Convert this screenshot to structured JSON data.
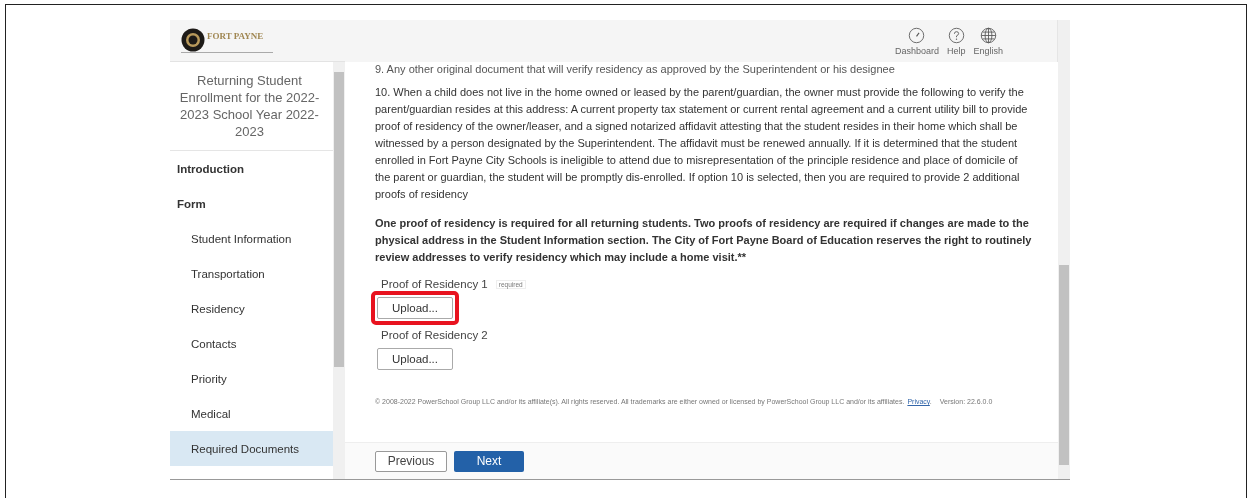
{
  "header": {
    "logo_text": "FORT PAYNE",
    "nav": [
      {
        "kind": "dashboard",
        "label": "Dashboard"
      },
      {
        "kind": "help",
        "label": "Help"
      },
      {
        "kind": "language",
        "label": "English"
      }
    ]
  },
  "sidebar": {
    "title": "Returning Student Enrollment for the 2022-2023 School Year 2022-2023",
    "items": [
      {
        "label": "Introduction",
        "selected": false
      },
      {
        "label": "Form",
        "selected": false,
        "children": [
          {
            "label": "Student Information",
            "selected": false
          },
          {
            "label": "Transportation",
            "selected": false
          },
          {
            "label": "Residency",
            "selected": false
          },
          {
            "label": "Contacts",
            "selected": false
          },
          {
            "label": "Priority",
            "selected": false
          },
          {
            "label": "Medical",
            "selected": false
          },
          {
            "label": "Required Documents",
            "selected": true
          }
        ]
      }
    ]
  },
  "content": {
    "paragraphs": [
      {
        "bold": false,
        "text": "9. Any other original document that will verify residency as approved by the Superintendent or his designee"
      },
      {
        "bold": false,
        "text": "10. When a child does not live in the home owned or leased by the parent/guardian, the owner must provide the following to verify the parent/guardian resides at this address: A current property tax statement or current rental agreement and a current utility bill to provide proof of residency of the owner/leaser, and a signed notarized affidavit attesting that the student resides in their home which shall be witnessed by a person designated by the Superintendent. The affidavit must be renewed annually. If it is determined that the student enrolled in Fort Payne City Schools is ineligible to attend due to misrepresentation of the principle residence and place of domicile of the parent or guardian, the student will be promptly dis-enrolled. If option 10 is selected, then you are required to provide 2 additional proofs of residency"
      },
      {
        "bold": true,
        "text": "One proof of residency is required for all returning students. Two proofs of residency are required if changes are made to the physical address in the Student Information section. The City of Fort Payne Board of Education reserves the right to routinely review addresses to verify residency which may include a home visit.**"
      }
    ],
    "uploads": [
      {
        "label": "Proof of Residency 1",
        "required_tag": "required",
        "button": "Upload...",
        "highlighted": true
      },
      {
        "label": "Proof of Residency 2",
        "button": "Upload...",
        "highlighted": false
      }
    ],
    "footer": {
      "copyright": "© 2008-2022 PowerSchool Group LLC and/or its affiliate(s). All rights reserved. All trademarks are either owned or licensed by PowerSchool Group LLC and/or its affiliates.",
      "privacy_link": "Privacy",
      "privacy_suffix": ".",
      "version": "Version: 22.6.0.0"
    }
  },
  "buttons": {
    "previous": "Previous",
    "next": "Next"
  }
}
